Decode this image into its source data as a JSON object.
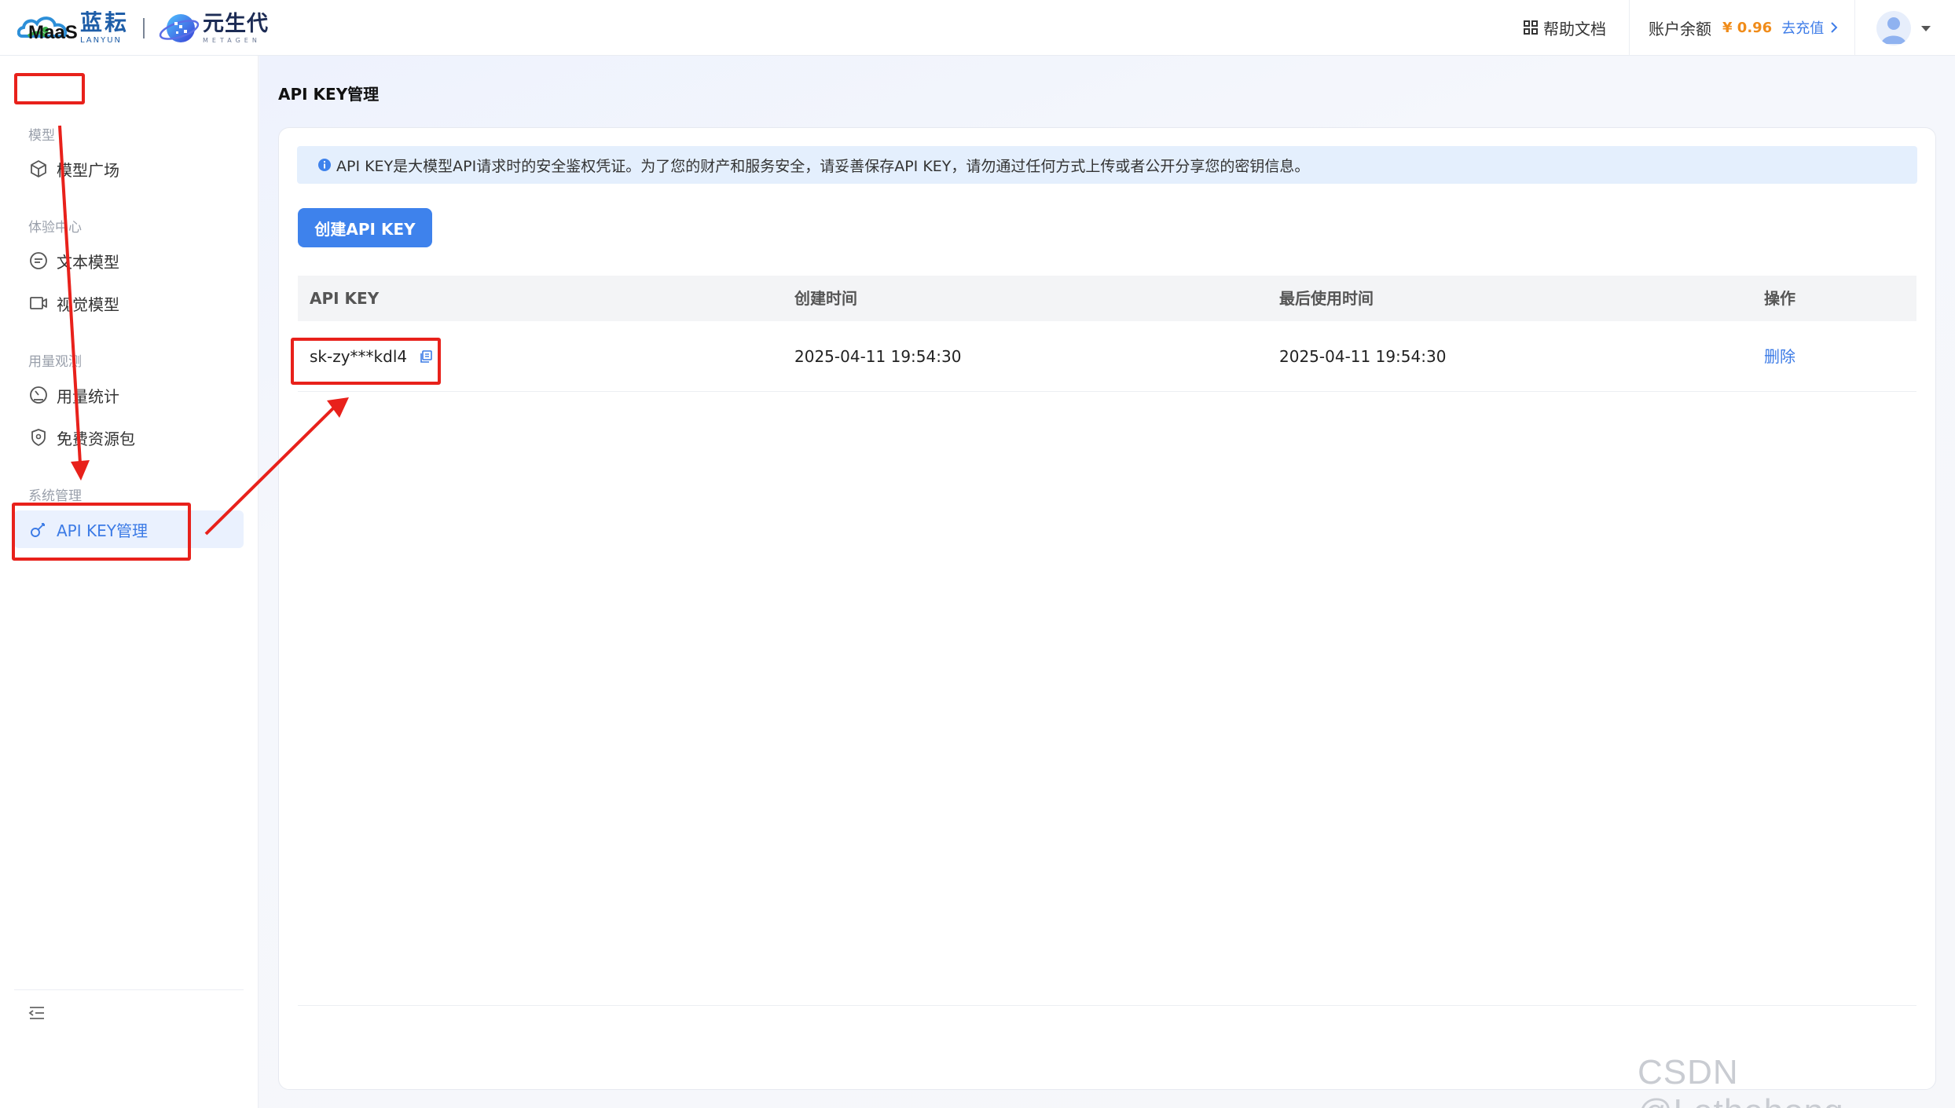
{
  "header": {
    "brand_lanyun_cn": "蓝耘",
    "brand_lanyun_en": "LANYUN",
    "brand_meta_cn": "元生代",
    "brand_meta_en": "METAGEN",
    "help_label": "帮助文档",
    "balance_label": "账户余额",
    "balance_amount": "¥ 0.96",
    "recharge_label": "去充值"
  },
  "sidebar": {
    "title": "MaaS",
    "groups": [
      {
        "label": "模型",
        "items": [
          {
            "label": "模型广场",
            "icon": "cube-icon"
          }
        ]
      },
      {
        "label": "体验中心",
        "items": [
          {
            "label": "文本模型",
            "icon": "chat-icon"
          },
          {
            "label": "视觉模型",
            "icon": "video-icon"
          }
        ]
      },
      {
        "label": "用量观测",
        "items": [
          {
            "label": "用量统计",
            "icon": "gauge-icon"
          },
          {
            "label": "免费资源包",
            "icon": "shield-location-icon"
          }
        ]
      },
      {
        "label": "系统管理",
        "items": [
          {
            "label": "API KEY管理",
            "icon": "key-icon",
            "active": true
          }
        ]
      }
    ]
  },
  "main": {
    "page_title": "API KEY管理",
    "notice": "API KEY是大模型API请求时的安全鉴权凭证。为了您的财产和服务安全，请妥善保存API KEY，请勿通过任何方式上传或者公开分享您的密钥信息。",
    "create_button": "创建API KEY",
    "table": {
      "columns": [
        "API KEY",
        "创建时间",
        "最后使用时间",
        "操作"
      ],
      "rows": [
        {
          "key": "sk-zy***kdl4",
          "created": "2025-04-11 19:54:30",
          "last_used": "2025-04-11 19:54:30",
          "action": "删除"
        }
      ]
    }
  },
  "watermark": "CSDN @Lethehong",
  "colors": {
    "accent": "#3e82ec",
    "annotation": "#e8211b",
    "balance": "#f08c1a"
  }
}
